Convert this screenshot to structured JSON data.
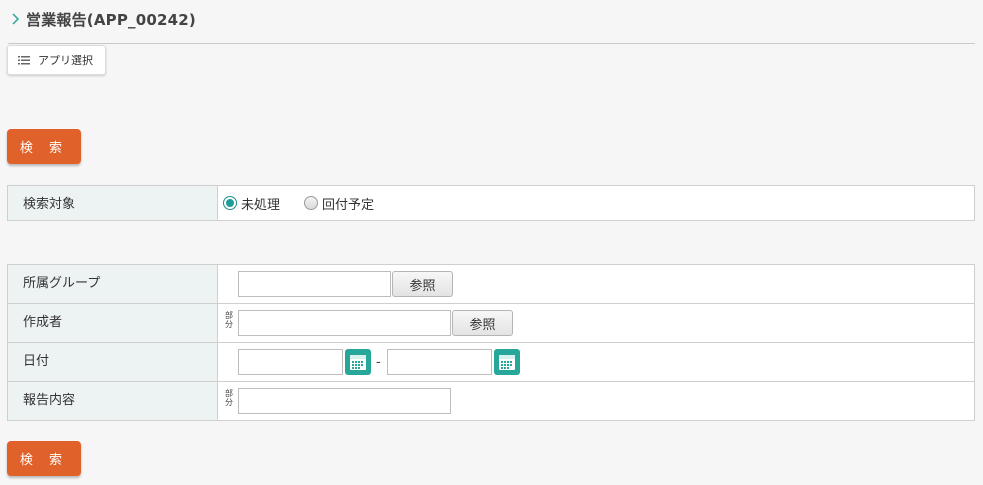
{
  "page": {
    "title": "営業報告(APP_00242)",
    "app_select_label": "アプリ選択"
  },
  "search_button_label": "検 索",
  "search_target": {
    "label": "検索対象",
    "options": [
      {
        "label": "未処理",
        "checked": true
      },
      {
        "label": "回付予定",
        "checked": false
      }
    ]
  },
  "fields": {
    "group": {
      "label": "所属グループ",
      "value": "",
      "button_label": "参照"
    },
    "author": {
      "label": "作成者",
      "value": "",
      "button_label": "参照",
      "match_mark": "部分"
    },
    "date": {
      "label": "日付",
      "from_value": "",
      "to_value": "",
      "separator": "-"
    },
    "content": {
      "label": "報告内容",
      "value": "",
      "match_mark": "部分"
    }
  },
  "colors": {
    "accent_orange": "#e0612a",
    "teal": "#26a79a",
    "label_bg": "#edf3f3"
  },
  "icons": {
    "title": "chevron-right-icon",
    "app_select": "list-icon",
    "date_picker": "calendar-icon"
  }
}
